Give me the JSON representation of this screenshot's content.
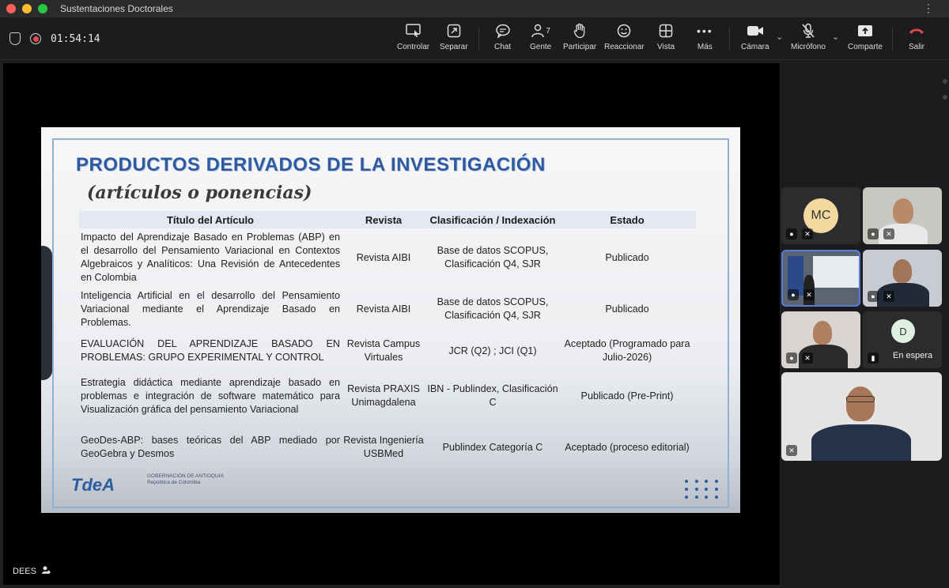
{
  "window": {
    "title": "Sustentaciones Doctorales"
  },
  "status": {
    "timer": "01:54:14"
  },
  "toolbar": {
    "controlar": "Controlar",
    "separar": "Separar",
    "chat": "Chat",
    "gente": "Gente",
    "gente_count": "7",
    "participar": "Participar",
    "reaccionar": "Reaccionar",
    "vista": "Vista",
    "mas": "Más",
    "camara": "Cámara",
    "microfono": "Micrófono",
    "comparte": "Comparte",
    "salir": "Salir"
  },
  "slide": {
    "title": "PRODUCTOS DERIVADOS DE LA INVESTIGACIÓN",
    "subtitle": "(artículos o ponencias)",
    "headers": [
      "Título del Artículo",
      "Revista",
      "Clasificación / Indexación",
      "Estado"
    ],
    "rows": [
      [
        "Impacto del Aprendizaje Basado en Problemas (ABP) en el desarrollo del Pensamiento Variacional en Contextos Algebraicos y Analíticos: Una Revisión de Antecedentes en Colombia",
        "Revista AIBI",
        "Base de datos SCOPUS, Clasificación Q4, SJR",
        "Publicado"
      ],
      [
        "Inteligencia Artificial en el desarrollo del Pensamiento Variacional mediante el Aprendizaje Basado en Problemas.",
        "Revista AIBI",
        "Base de datos SCOPUS, Clasificación Q4, SJR",
        "Publicado"
      ],
      [
        "EVALUACIÓN DEL APRENDIZAJE BASADO EN PROBLEMAS: GRUPO EXPERIMENTAL Y CONTROL",
        "Revista Campus Virtuales",
        "JCR (Q2) ; JCI (Q1)",
        "Aceptado (Programado para Julio-2026)"
      ],
      [
        "Estrategia didáctica mediante aprendizaje basado en problemas e integración de software matemático para Visualización gráfica del pensamiento Variacional",
        "Revista PRAXIS Unimagdalena",
        "IBN - Publindex, Clasificación C",
        "Publicado (Pre-Print)"
      ],
      [
        "GeoDes-ABP: bases teóricas del ABP mediado por GeoGebra y Desmos",
        "Revista Ingeniería USBMed",
        "Publindex Categoría C",
        "Aceptado (proceso editorial)"
      ]
    ],
    "logo_tdea": "TdeA",
    "logo_gob_line1": "GOBERNACIÓN DE ANTIOQUIA",
    "logo_gob_line2": "República de Colombia"
  },
  "stage": {
    "presenter_label": "DEES"
  },
  "participants": {
    "mc_initials": "MC",
    "d_initial": "D",
    "d_status": "En espera"
  },
  "colors": {
    "accent_red": "#e5484d",
    "title_blue": "#2e5aa0",
    "tile_bg": "#2c2c2e"
  }
}
